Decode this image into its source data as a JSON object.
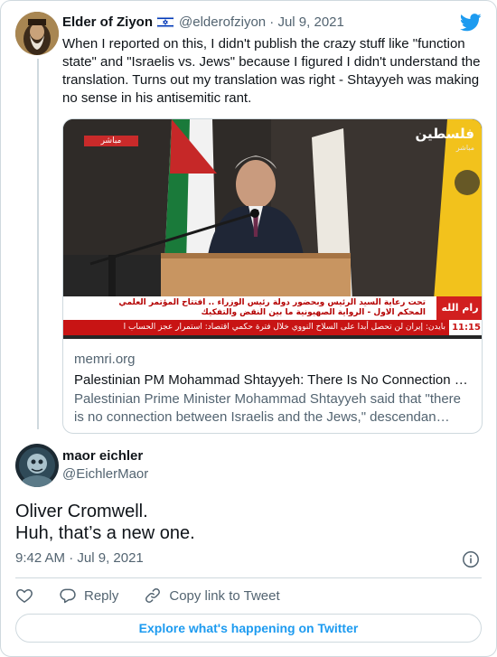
{
  "parent_tweet": {
    "author_name": "Elder of Ziyon",
    "handle": "@elderofziyon",
    "separator": "·",
    "date": "Jul 9, 2021",
    "text": "When I reported on this, I didn't publish the crazy stuff like \"function state\" and \"Israelis vs. Jews\" because I figured I didn't understand the translation. Turns out my translation was right - Shtayyeh was making no sense in his antisemitic rant.",
    "avatar_label": "ZIYON.COM",
    "link_card": {
      "domain": "memri.org",
      "title": "Palestinian PM Mohammad Shtayyeh: There Is No Connection …",
      "description": "Palestinian Prime Minister Mohammad Shtayyeh said that \"there is no connection between Israelis and the Jews,\" descendan…",
      "image": {
        "live_badge": "مباشر",
        "channel_name": "فلسطين",
        "channel_sub": "مباشر",
        "headline_line1": "تحت رعاية السيد الرئيس وبحضور دولة رئيس الوزراء .. افتتاح المؤتمر العلمي",
        "headline_line2": "المحكم الاول - الرواية الصهيونية ما بين النقض والتفكيك",
        "location": "رام الله",
        "ticker": "بايدن: إيران لن تحصل أبدا على السلاح النووي خلال فترة حكمي    اقتصاد: استمرار عجز الحساب ا",
        "clock": "11:15"
      }
    }
  },
  "reply_tweet": {
    "author_name": "maor eichler",
    "handle": "@EichlerMaor",
    "text_lines": [
      "Oliver Cromwell.",
      "Huh, that’s a new one."
    ],
    "time": "9:42 AM",
    "separator": "·",
    "date": "Jul 9, 2021"
  },
  "actions": {
    "reply_label": "Reply",
    "copy_label": "Copy link to Tweet"
  },
  "footer": {
    "explore_label": "Explore what's happening on Twitter"
  },
  "colors": {
    "accent": "#1d9bf0",
    "muted": "#536471",
    "border": "#cfd9de"
  },
  "icons": [
    "israel-flag-icon",
    "twitter-bird-icon",
    "info-icon",
    "heart-icon",
    "reply-bubble-icon",
    "link-icon"
  ]
}
